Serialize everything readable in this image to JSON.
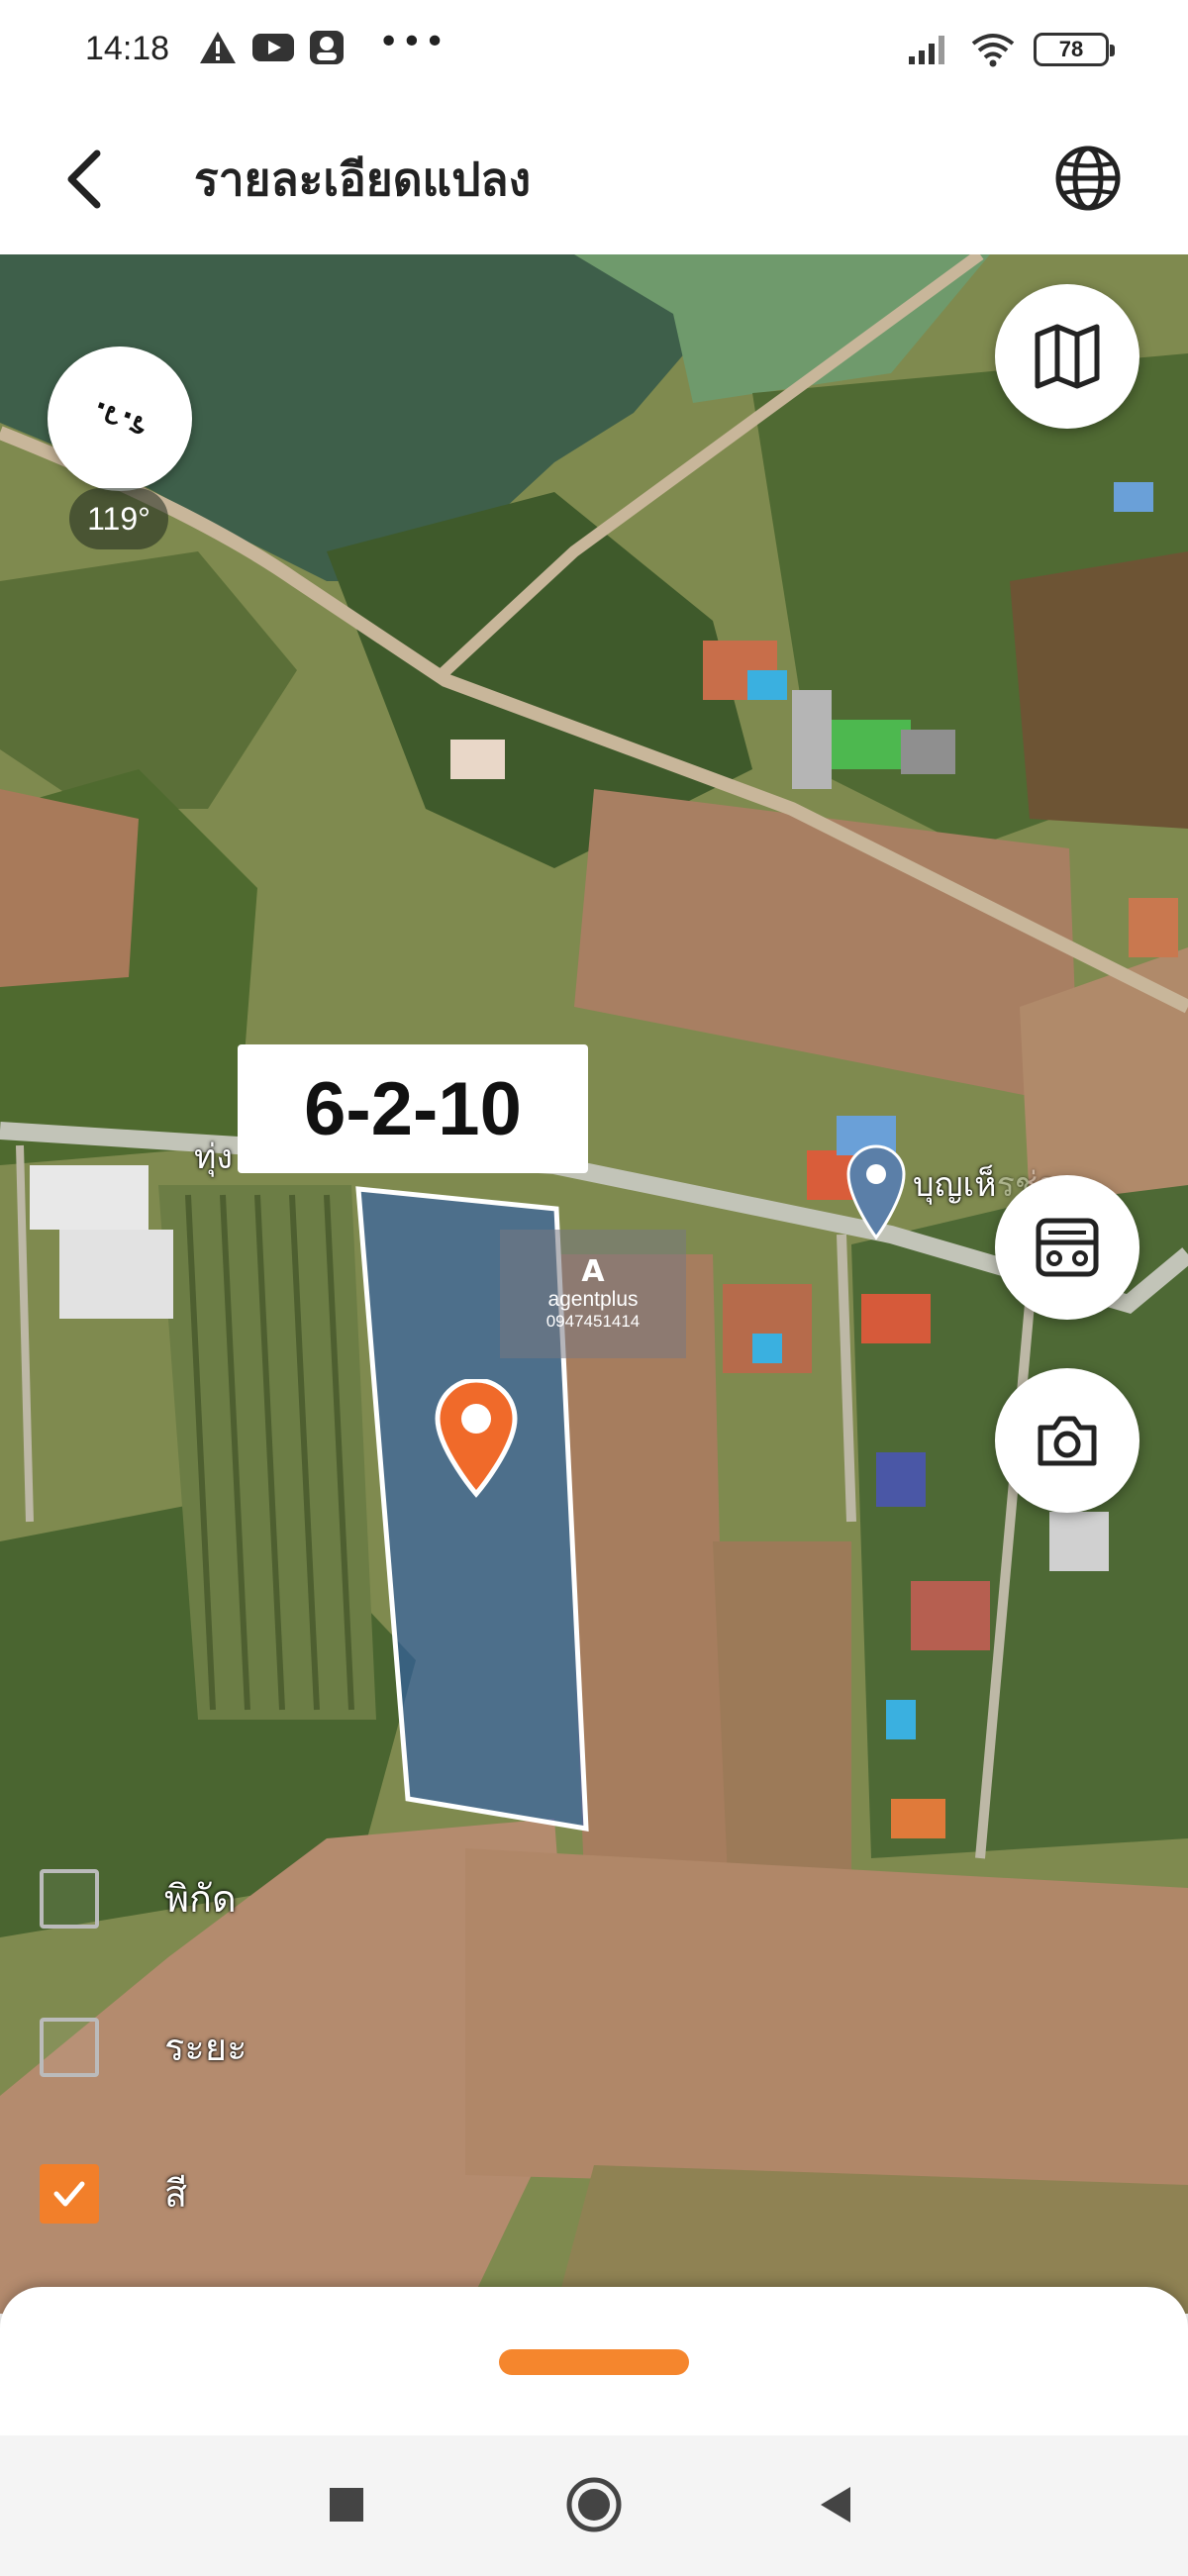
{
  "status_bar": {
    "time": "14:18",
    "battery": "78",
    "icons": [
      "warning-icon",
      "youtube-icon",
      "app-icon",
      "more-dots-icon",
      "signal-icon",
      "wifi-icon",
      "battery-icon"
    ]
  },
  "header": {
    "title": "รายละเอียดแปลง",
    "back_icon": "back-arrow-icon",
    "globe_icon": "globe-icon"
  },
  "map": {
    "compass_label": "ร.ว.",
    "heading": "119°",
    "plot_size": "6-2-10",
    "road_label_left": "ทุ่ง",
    "poi_label": "บุญเห็",
    "poi_label_tail": "รช่าง",
    "watermark": {
      "logo": "A",
      "name": "agentplus",
      "phone": "0947451414"
    },
    "buttons": {
      "map_type_icon": "map-icon",
      "report_icon": "report-icon",
      "camera_icon": "camera-icon"
    },
    "layers": [
      {
        "label": "พิกัด",
        "checked": false
      },
      {
        "label": "ระยะ",
        "checked": false
      },
      {
        "label": "สี",
        "checked": true
      }
    ],
    "accent_color": "#f27f2a",
    "plot_fill_color": "#2f5fb0"
  },
  "nav_bar": {
    "icons": [
      "recent-apps-icon",
      "home-icon",
      "back-nav-icon"
    ]
  }
}
